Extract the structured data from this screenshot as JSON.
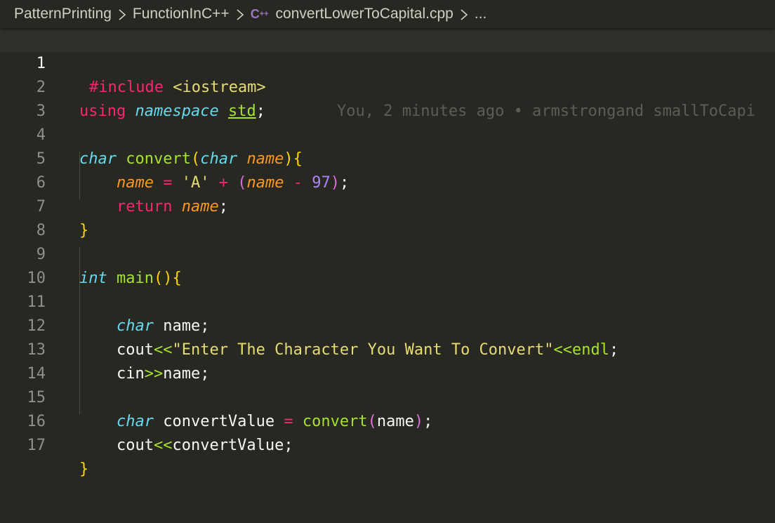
{
  "breadcrumb": {
    "items": [
      "PatternPrinting",
      "FunctionInC++",
      "convertLowerToCapital.cpp",
      "..."
    ],
    "file_icon": "cpp-file-icon"
  },
  "editor": {
    "current_line": 1,
    "blame": "You, 2 minutes ago • armstrongand smallToCapi",
    "line_numbers": [
      "1",
      "2",
      "3",
      "4",
      "5",
      "6",
      "7",
      "8",
      "9",
      "10",
      "11",
      "12",
      "13",
      "14",
      "15",
      "16",
      "17"
    ]
  },
  "colors": {
    "background": "#272822",
    "keyword": "#f92672",
    "type": "#66d9ef",
    "parameter": "#fd971f",
    "function": "#a6e22e",
    "string": "#e6db74",
    "number": "#ae81ff",
    "bracket": "#ffd700"
  }
}
